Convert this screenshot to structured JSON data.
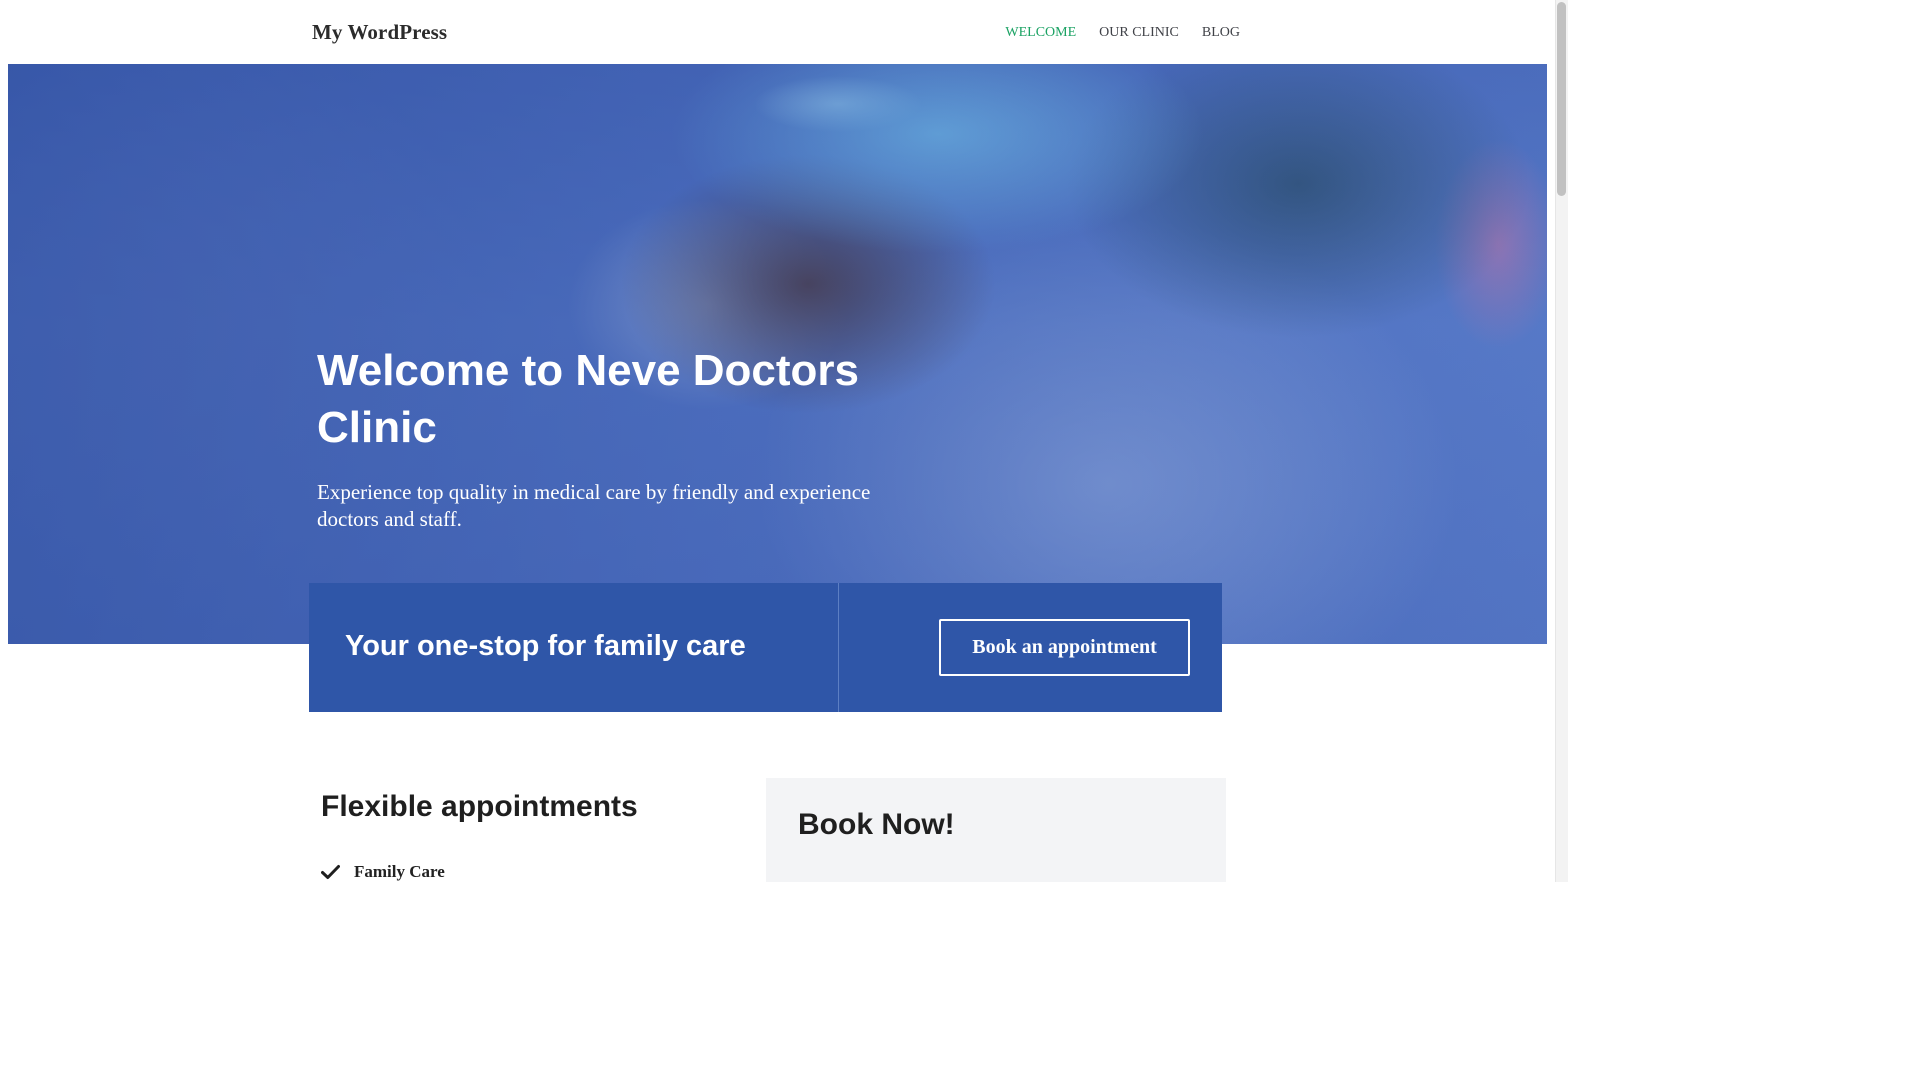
{
  "header": {
    "site_title": "My WordPress",
    "nav": [
      {
        "label": "WELCOME",
        "active": true
      },
      {
        "label": "OUR CLINIC",
        "active": false
      },
      {
        "label": "BLOG",
        "active": false
      }
    ]
  },
  "hero": {
    "title": "Welcome to Neve Doctors Clinic",
    "subtitle": "Experience top quality in medical care by friendly and experience doctors and staff."
  },
  "banner": {
    "text": "Your one-stop for family care",
    "button_label": "Book an appointment"
  },
  "features": {
    "title": "Flexible appointments",
    "items": [
      {
        "label": "Family Care",
        "icon": "check-icon"
      }
    ]
  },
  "book_card": {
    "title": "Book Now!"
  },
  "colors": {
    "accent_green": "#1aa263",
    "banner_blue": "#2f56a8",
    "text_dark": "#1f1f1f"
  }
}
